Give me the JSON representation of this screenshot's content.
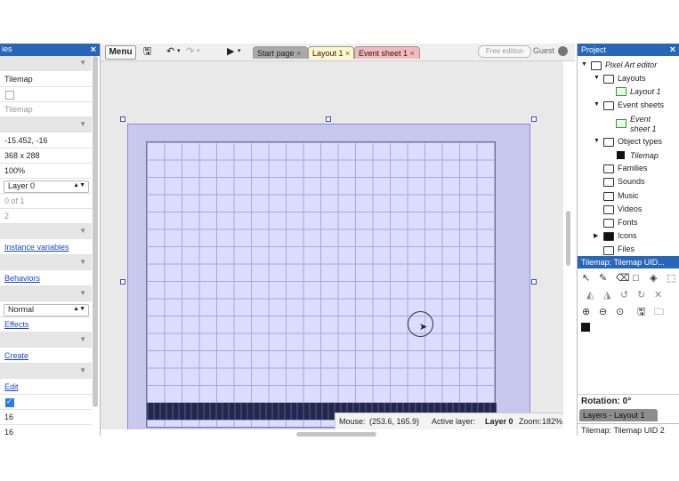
{
  "left_panel": {
    "header_title": "ies",
    "rows": {
      "name": "Tilemap",
      "plugin": "Tilemap",
      "position": "-15.452, -16",
      "size": "368 x 288",
      "opacity": "100%",
      "layer": "Layer 0",
      "z_index": "0 of 1",
      "uid": "2",
      "instance_variables": "Instance variables",
      "behaviors": "Behaviors",
      "blend_mode": "Normal",
      "effects": "Effects",
      "create": "Create",
      "edit": "Edit",
      "tile_width": "16",
      "tile_height": "16"
    },
    "close_icon": "close-icon"
  },
  "toolbar": {
    "menu_label": "Menu",
    "tabs": [
      {
        "label": "Start page",
        "color": "#a9a9a9"
      },
      {
        "label": "Layout 1",
        "color": "#fff6c8"
      },
      {
        "label": "Event sheet 1",
        "color": "#f4b9b9"
      }
    ],
    "tab_close": "×",
    "free_edition": "Free edition",
    "guest": "Guest"
  },
  "status_bar": {
    "mouse_label": "Mouse:",
    "mouse_value": "(253.6, 165.9)",
    "active_layer_label": "Active layer:",
    "active_layer_value": "Layer 0",
    "zoom_label": "Zoom:",
    "zoom_value": "182%"
  },
  "project": {
    "header": "Project",
    "root": "Pixel Art editor",
    "layouts": "Layouts",
    "layout_1": "Layout 1",
    "event_sheets": "Event sheets",
    "event_sheet_1_line1": "Event",
    "event_sheet_1_line2": "sheet 1",
    "object_types": "Object types",
    "tilemap": "Tilemap",
    "families": "Families",
    "sounds": "Sounds",
    "music": "Music",
    "videos": "Videos",
    "fonts": "Fonts",
    "icons": "Icons",
    "files": "Files"
  },
  "tilemap_bar": {
    "header": "Tilemap: Tilemap UID..."
  },
  "bottom_right": {
    "rotation": "Rotation: 0°",
    "layers_tab": "Layers - Layout 1",
    "tilemap_tab": "Tilemap: Tilemap UID 2"
  },
  "colors": {
    "panel_header": "#2a66b8",
    "layout_bg": "#c8c8ef",
    "grid_bg": "#dcdcff",
    "tile_dark": "#23284a"
  }
}
